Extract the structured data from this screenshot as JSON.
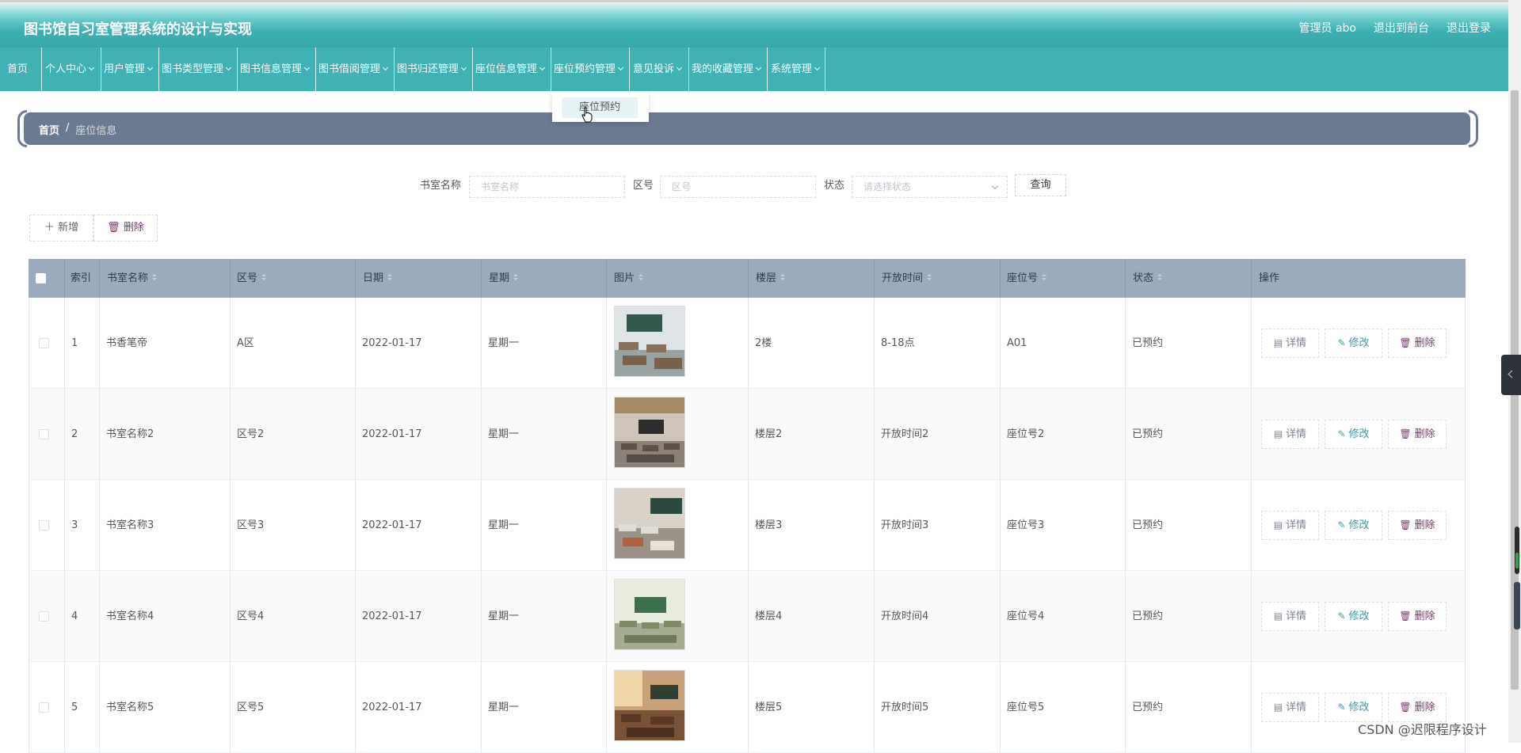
{
  "header": {
    "app_title": "图书馆自习室管理系统的设计与实现",
    "user_label": "管理员 abo",
    "back_to_front": "退出到前台",
    "logout": "退出登录"
  },
  "nav": {
    "items": [
      {
        "label": "首页",
        "has_arrow": false
      },
      {
        "label": "个人中心",
        "has_arrow": true
      },
      {
        "label": "用户管理",
        "has_arrow": true
      },
      {
        "label": "图书类型管理",
        "has_arrow": true
      },
      {
        "label": "图书信息管理",
        "has_arrow": true
      },
      {
        "label": "图书借阅管理",
        "has_arrow": true
      },
      {
        "label": "图书归还管理",
        "has_arrow": true
      },
      {
        "label": "座位信息管理",
        "has_arrow": true
      },
      {
        "label": "座位预约管理",
        "has_arrow": true
      },
      {
        "label": "意见投诉",
        "has_arrow": true
      },
      {
        "label": "我的收藏管理",
        "has_arrow": true
      },
      {
        "label": "系统管理",
        "has_arrow": true
      }
    ],
    "dropdown_item": "座位预约"
  },
  "breadcrumb": {
    "home": "首页",
    "separator": "/",
    "current": "座位信息"
  },
  "search": {
    "room_label": "书室名称",
    "room_placeholder": "书室名称",
    "zone_label": "区号",
    "zone_placeholder": "区号",
    "status_label": "状态",
    "status_placeholder": "请选择状态",
    "query_button": "查询"
  },
  "toolbar": {
    "add_label": "新增",
    "delete_label": "删除"
  },
  "table": {
    "columns": [
      "索引",
      "书室名称",
      "区号",
      "日期",
      "星期",
      "图片",
      "楼层",
      "开放时间",
      "座位号",
      "状态",
      "操作"
    ],
    "rows": [
      {
        "index": "1",
        "room": "书香笔帝",
        "zone": "A区",
        "date": "2022-01-17",
        "weekday": "星期一",
        "floor": "2楼",
        "open_time": "8-18点",
        "seat": "A01",
        "status": "已预约"
      },
      {
        "index": "2",
        "room": "书室名称2",
        "zone": "区号2",
        "date": "2022-01-17",
        "weekday": "星期一",
        "floor": "楼层2",
        "open_time": "开放时间2",
        "seat": "座位号2",
        "status": "已预约"
      },
      {
        "index": "3",
        "room": "书室名称3",
        "zone": "区号3",
        "date": "2022-01-17",
        "weekday": "星期一",
        "floor": "楼层3",
        "open_time": "开放时间3",
        "seat": "座位号3",
        "status": "已预约"
      },
      {
        "index": "4",
        "room": "书室名称4",
        "zone": "区号4",
        "date": "2022-01-17",
        "weekday": "星期一",
        "floor": "楼层4",
        "open_time": "开放时间4",
        "seat": "座位号4",
        "status": "已预约"
      },
      {
        "index": "5",
        "room": "书室名称5",
        "zone": "区号5",
        "date": "2022-01-17",
        "weekday": "星期一",
        "floor": "楼层5",
        "open_time": "开放时间5",
        "seat": "座位号5",
        "status": "已预约"
      }
    ],
    "actions": {
      "detail": "详情",
      "edit": "修改",
      "delete": "删除"
    }
  },
  "watermark": "CSDN @迟限程序设计",
  "colors": {
    "header_teal": "#3fb2b6",
    "breadcrumb_bg": "#6b7a93",
    "table_header_bg": "#9babbf"
  }
}
